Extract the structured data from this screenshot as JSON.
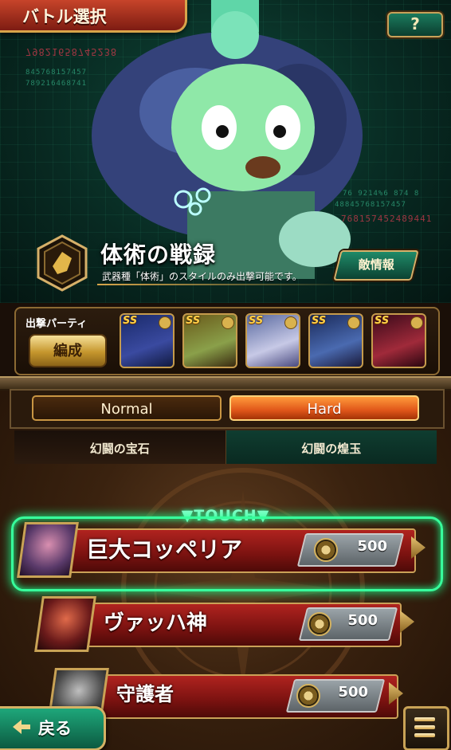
{
  "header": {
    "title": "バトル選択",
    "help_label": "?"
  },
  "record": {
    "title": "体術の戦録",
    "subtitle": "武器種「体術」のスタイルのみ出撃可能です。",
    "enemy_info_label": "敵情報"
  },
  "party": {
    "label": "出撃パーティ",
    "edit_label": "編成",
    "members": [
      {
        "rank": "SS"
      },
      {
        "rank": "SS"
      },
      {
        "rank": "SS"
      },
      {
        "rank": "SS"
      },
      {
        "rank": "SS"
      }
    ]
  },
  "difficulty": {
    "normal_label": "Normal",
    "hard_label": "Hard",
    "selected": "Hard"
  },
  "tabs": [
    {
      "label": "幻闘の宝石"
    },
    {
      "label": "幻闘の煌玉"
    }
  ],
  "touch_label": "▼TOUCH▼",
  "background_digits": {
    "d1": "79821658745238",
    "d2": "845768157457",
    "d3": "789216468741",
    "d4": "76 9214%6 874 8",
    "d5": "48845768157457",
    "d6": "768157452489441"
  },
  "quests": [
    {
      "name": "巨大コッペリア",
      "cost": "500"
    },
    {
      "name": "ヴァッハ神",
      "cost": "500"
    },
    {
      "name": "守護者",
      "cost": "500"
    }
  ],
  "footer": {
    "back_label": "戻る"
  },
  "colors": {
    "accent_green": "#37ff9c",
    "gold": "#caa157",
    "hard_orange": "#e0561a"
  }
}
